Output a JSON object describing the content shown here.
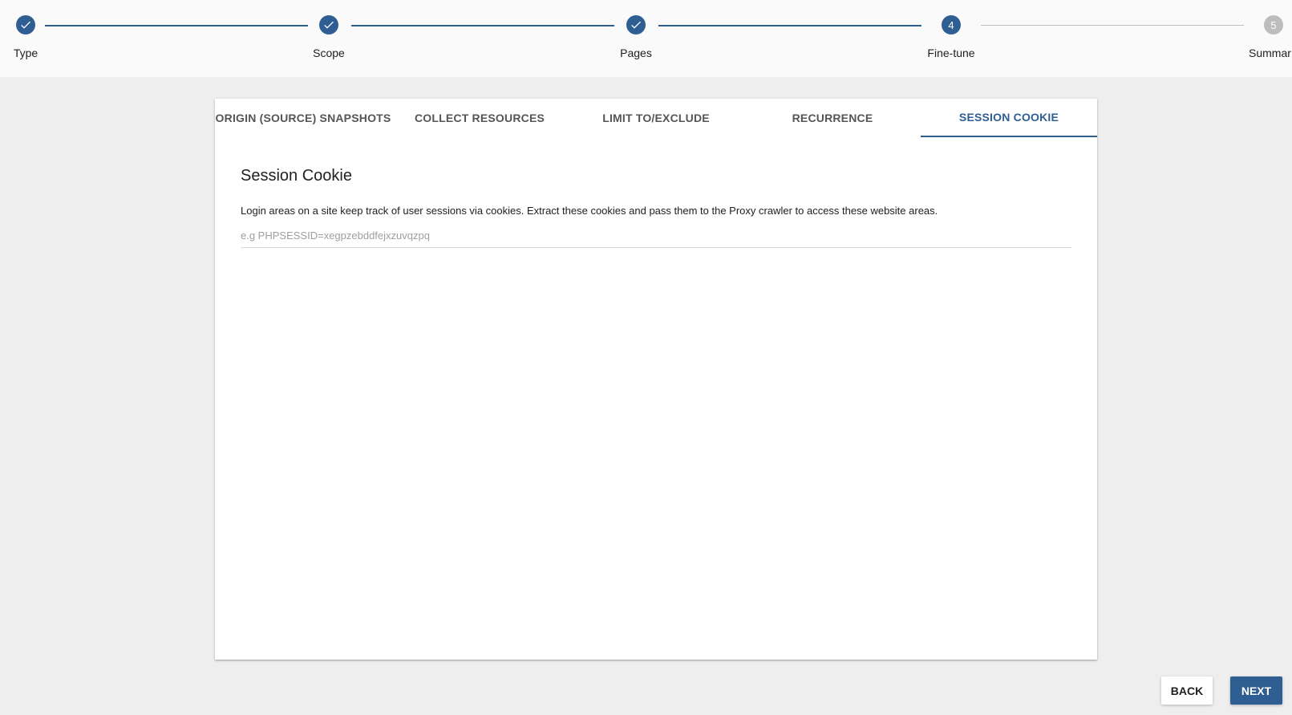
{
  "stepper": {
    "steps": [
      {
        "label": "Type",
        "status": "done",
        "icon": "check-icon"
      },
      {
        "label": "Scope",
        "status": "done",
        "icon": "check-icon"
      },
      {
        "label": "Pages",
        "status": "done",
        "icon": "check-icon"
      },
      {
        "label": "Fine-tune",
        "status": "active",
        "number": "4"
      },
      {
        "label": "Summar",
        "status": "pending",
        "number": "5"
      }
    ]
  },
  "tabs": [
    {
      "label": "ORIGIN (SOURCE) SNAPSHOTS"
    },
    {
      "label": "COLLECT RESOURCES"
    },
    {
      "label": "LIMIT TO/EXCLUDE"
    },
    {
      "label": "RECURRENCE"
    },
    {
      "label": "SESSION COOKIE",
      "active": true
    }
  ],
  "session": {
    "title": "Session Cookie",
    "description": "Login areas on a site keep track of user sessions via cookies. Extract these cookies and pass them to the Proxy crawler to access these website areas.",
    "input_value": "",
    "input_placeholder": "e.g PHPSESSID=xegpzebddfejxzuvqzpq"
  },
  "actions": {
    "back_label": "BACK",
    "next_label": "NEXT"
  },
  "colors": {
    "primary": "#2f5e93",
    "pending": "#bdbdbd",
    "background": "#eeeeee"
  }
}
